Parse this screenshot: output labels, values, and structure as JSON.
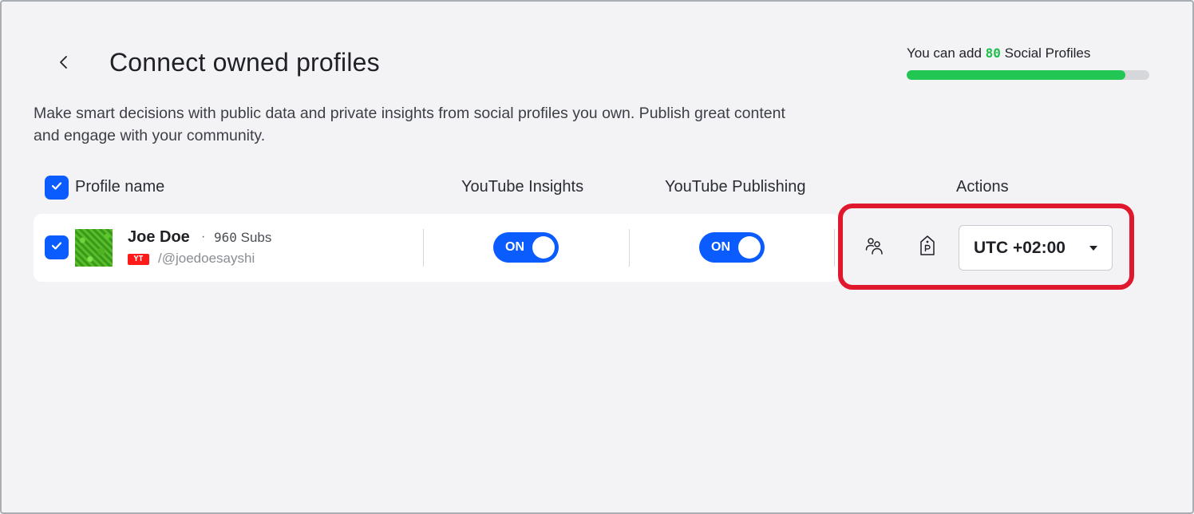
{
  "header": {
    "title": "Connect owned profiles",
    "back_icon": "chevron-left-icon"
  },
  "quota": {
    "prefix": "You can add",
    "count": "80",
    "suffix": "Social Profiles",
    "progress_fraction": 0.9
  },
  "description": "Make smart decisions with public data and private insights from social profiles you own. Publish great content and engage with your community.",
  "table": {
    "columns": {
      "profile_name": "Profile name",
      "insights": "YouTube Insights",
      "publishing": "YouTube Publishing",
      "actions": "Actions"
    },
    "select_all_checked": true,
    "rows": [
      {
        "checked": true,
        "name": "Joe Doe",
        "separator": "·",
        "subs_count": "960",
        "subs_label": "Subs",
        "network_badge": "YT",
        "handle": "/@joedoesayshi",
        "insights_toggle": "ON",
        "publishing_toggle": "ON",
        "actions": {
          "team_icon": "people-icon",
          "tag_icon": "tag-p-icon",
          "timezone": "UTC +02:00"
        }
      }
    ]
  },
  "colors": {
    "accent": "#0b5cff",
    "progress": "#22c652",
    "highlight": "#e0182d",
    "badge": "#ff1a1a"
  }
}
